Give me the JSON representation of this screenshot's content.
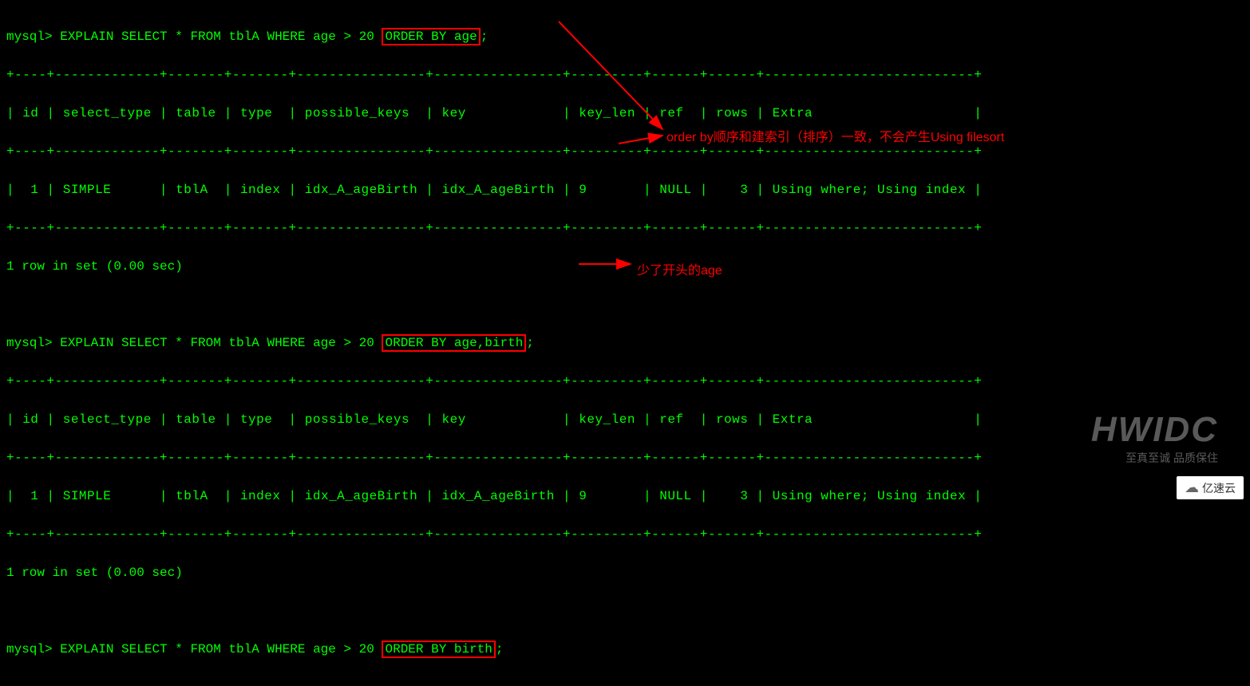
{
  "prompt": "mysql> ",
  "query1": {
    "pre": "EXPLAIN SELECT * FROM tblA WHERE age > 20 ",
    "highlighted": "ORDER BY age",
    "post": ";"
  },
  "table1": {
    "headers": [
      "id",
      "select_type",
      "table",
      "type",
      "possible_keys",
      "key",
      "key_len",
      "ref",
      "rows",
      "Extra"
    ],
    "row": {
      "id": "1",
      "select_type": "SIMPLE",
      "table": "tblA",
      "type": "index",
      "possible_keys": "idx_A_ageBirth",
      "key": "idx_A_ageBirth",
      "key_len": "9",
      "ref": "NULL",
      "rows": "3",
      "Extra": "Using where; Using index"
    },
    "separator": "+----+-------------+-------+-------+----------------+----------------+---------+------+------+--------------------------+",
    "header_line": "| id | select_type | table | type  | possible_keys  | key            | key_len | ref  | rows | Extra                    |",
    "data_line": "|  1 | SIMPLE      | tblA  | index | idx_A_ageBirth | idx_A_ageBirth | 9       | NULL |    3 | Using where; Using index |"
  },
  "result1": "1 row in set (0.00 sec)",
  "query2": {
    "pre": "EXPLAIN SELECT * FROM tblA WHERE age > 20 ",
    "highlighted": "ORDER BY age,birth",
    "post": ";"
  },
  "table2": {
    "separator": "+----+-------------+-------+-------+----------------+----------------+---------+------+------+--------------------------+",
    "header_line": "| id | select_type | table | type  | possible_keys  | key            | key_len | ref  | rows | Extra                    |",
    "data_line": "|  1 | SIMPLE      | tblA  | index | idx_A_ageBirth | idx_A_ageBirth | 9       | NULL |    3 | Using where; Using index |"
  },
  "result2": "1 row in set (0.00 sec)",
  "query3": {
    "pre": "EXPLAIN SELECT * FROM tblA WHERE age > 20 ",
    "highlighted": "ORDER BY birth",
    "post": ";"
  },
  "annotation1": "order by顺序和建索引（排序）一致，不会产生Using filesort",
  "annotation2": "少了开头的age",
  "watermark": {
    "main": "HWIDC",
    "sub": "至真至诚 品质保住",
    "yisu": "亿速云"
  }
}
